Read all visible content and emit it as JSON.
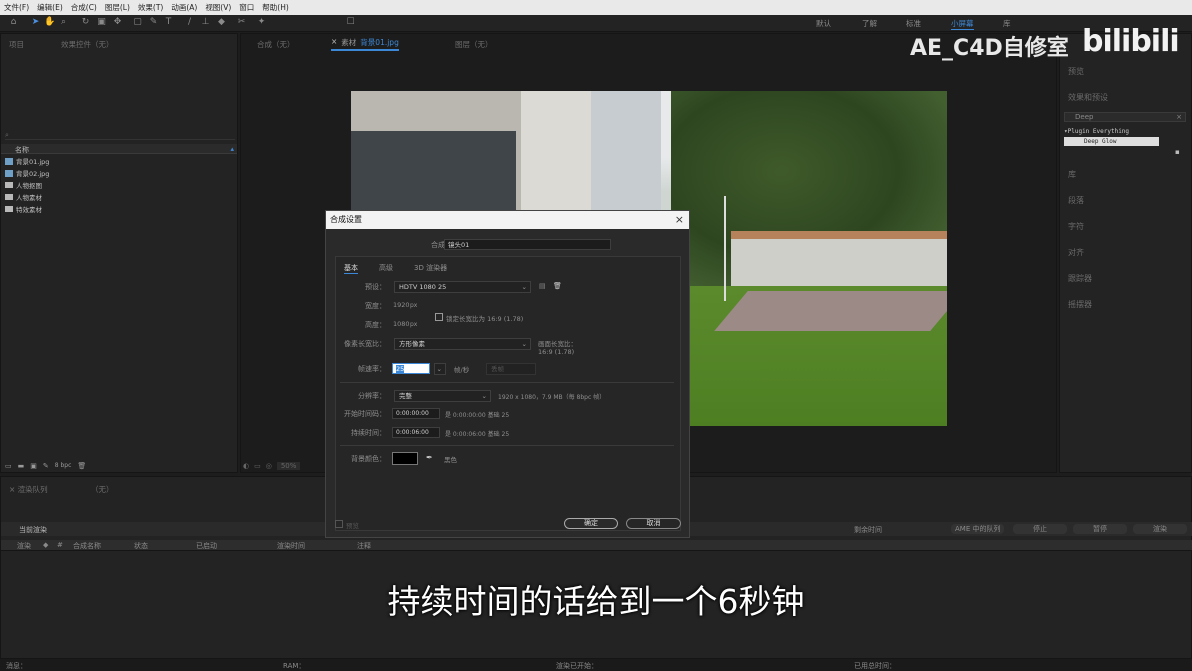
{
  "menu": [
    "文件(F)",
    "编辑(E)",
    "合成(C)",
    "图层(L)",
    "效果(T)",
    "动画(A)",
    "视图(V)",
    "窗口",
    "帮助(H)"
  ],
  "workspaces": [
    "默认",
    "了解",
    "标准",
    "小屏幕",
    "库"
  ],
  "left_panel": {
    "tab_project": "项目",
    "tab_effects": "效果控件（无）",
    "col_name": "名称",
    "items": [
      {
        "label": "背景01.jpg",
        "type": "image"
      },
      {
        "label": "背景02.jpg",
        "type": "image"
      },
      {
        "label": "人物抠图",
        "type": "folder"
      },
      {
        "label": "人物素材",
        "type": "folder"
      },
      {
        "label": "特效素材",
        "type": "folder"
      }
    ],
    "bpc": "8 bpc"
  },
  "viewer_tabs": {
    "comp": "合成（无）",
    "footage_prefix": "素材",
    "footage_file": "背景01.jpg",
    "layer": "图层（无）"
  },
  "viewer_zoom": "50%",
  "right_panel": {
    "preview": "预览",
    "effects_presets": "效果和预设",
    "search_value": "Deep",
    "plugin": "Plugin Everything",
    "effect": "Deep Glow",
    "items": [
      "库",
      "段落",
      "字符",
      "对齐",
      "跟踪器",
      "摇摆器"
    ]
  },
  "dialog": {
    "title": "合成设置",
    "comp_name_label": "合成名称：",
    "comp_name_value": "镜头01",
    "tabs": [
      "基本",
      "高级",
      "3D 渲染器"
    ],
    "preset_label": "预设：",
    "preset_value": "HDTV 1080 25",
    "width_label": "宽度：",
    "width_value": "1920",
    "width_unit": "px",
    "height_label": "高度：",
    "height_value": "1080",
    "height_unit": "px",
    "lock_ratio": "锁定长宽比为 16:9 (1.78)",
    "par_label": "像素长宽比：",
    "par_value": "方形像素",
    "frame_aspect_label": "画面长宽比：",
    "frame_aspect_value": "16:9 (1.78)",
    "fps_label": "帧速率：",
    "fps_value": "25",
    "fps_unit": "帧/秒",
    "drop_frame": "丢帧",
    "res_label": "分辨率：",
    "res_value": "完整",
    "res_info": "1920 x 1080，7.9 MB（每 8bpc 帧）",
    "start_label": "开始时间码：",
    "start_value": "0:00:00:00",
    "start_info": "是 0:00:00:00  基础 25",
    "duration_label": "持续时间：",
    "duration_value": "0:00:06:00",
    "duration_info": "是 0:00:06:00  基础 25",
    "bg_label": "背景颜色：",
    "bg_name": "黑色",
    "bg_color": "#000000",
    "preview_label": "预览",
    "ok": "确定",
    "cancel": "取消"
  },
  "render_queue": {
    "tab": "渲染队列",
    "tab2": "（无）",
    "current": "当前渲染",
    "remaining": "剩余时间",
    "ame": "AME 中的队列",
    "stop": "停止",
    "pause": "暂停",
    "render": "渲染",
    "cols": [
      "渲染",
      "#",
      "合成名称",
      "状态",
      "已启动",
      "渲染时间",
      "注释"
    ]
  },
  "status_bar": [
    "消息：",
    "RAM：",
    "渲染已开始：",
    "已用总时间："
  ],
  "watermark": "AE_C4D自修室",
  "bili": "bilibili",
  "subtitle": "持续时间的话给到一个6秒钟"
}
